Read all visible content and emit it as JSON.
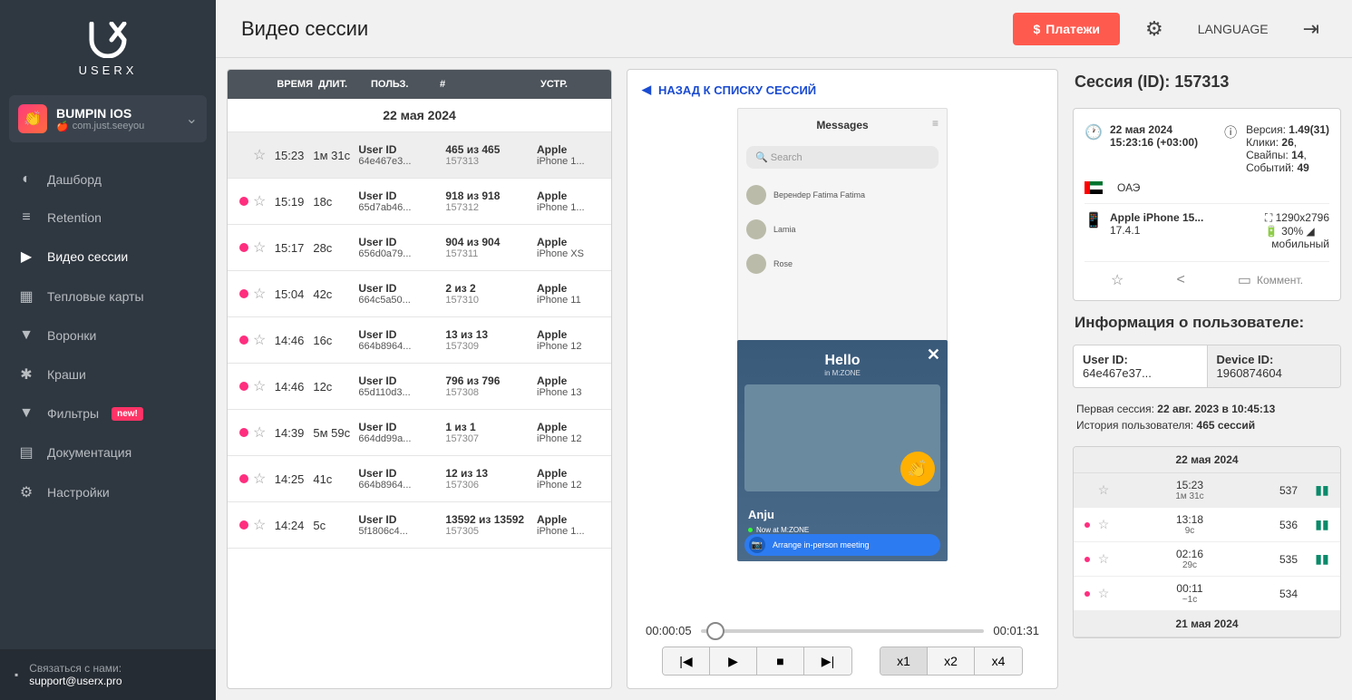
{
  "logo_text": "USERX",
  "app": {
    "name": "BUMPIN IOS",
    "id": "com.just.seeyou",
    "icon": "👏"
  },
  "nav": [
    {
      "icon": "◐",
      "label": "Дашборд"
    },
    {
      "icon": "≡",
      "label": "Retention"
    },
    {
      "icon": "▶",
      "label": "Видео сессии",
      "active": true
    },
    {
      "icon": "▦",
      "label": "Тепловые карты"
    },
    {
      "icon": "▼",
      "label": "Воронки"
    },
    {
      "icon": "✱",
      "label": "Краши"
    },
    {
      "icon": "▼",
      "label": "Фильтры",
      "badge": "new!"
    },
    {
      "icon": "▤",
      "label": "Документация"
    },
    {
      "icon": "⚙",
      "label": "Настройки"
    }
  ],
  "contact": {
    "label": "Связаться с нами:",
    "email": "support@userx.pro"
  },
  "page_title": "Видео сессии",
  "pay_btn": "Платежи",
  "lang": "LANGUAGE",
  "sess_head": {
    "time": "ВРЕМЯ",
    "dur": "ДЛИТ.",
    "user": "ПОЛЬЗ.",
    "num": "#",
    "dev": "УСТР."
  },
  "sess_date": "22 мая 2024",
  "sessions": [
    {
      "sel": true,
      "dot": false,
      "time": "15:23",
      "dur": "1м 31с",
      "uid": "64e467e3...",
      "num": "465 из 465",
      "sid": "157313",
      "dev": "Apple",
      "model": "iPhone 1..."
    },
    {
      "dot": true,
      "time": "15:19",
      "dur": "18с",
      "uid": "65d7ab46...",
      "num": "918 из 918",
      "sid": "157312",
      "dev": "Apple",
      "model": "iPhone 1..."
    },
    {
      "dot": true,
      "time": "15:17",
      "dur": "28с",
      "uid": "656d0a79...",
      "num": "904 из 904",
      "sid": "157311",
      "dev": "Apple",
      "model": "iPhone XS"
    },
    {
      "dot": true,
      "time": "15:04",
      "dur": "42с",
      "uid": "664c5a50...",
      "num": "2 из 2",
      "sid": "157310",
      "dev": "Apple",
      "model": "iPhone 11"
    },
    {
      "dot": true,
      "time": "14:46",
      "dur": "16с",
      "uid": "664b8964...",
      "num": "13 из 13",
      "sid": "157309",
      "dev": "Apple",
      "model": "iPhone 12"
    },
    {
      "dot": true,
      "time": "14:46",
      "dur": "12с",
      "uid": "65d110d3...",
      "num": "796 из 796",
      "sid": "157308",
      "dev": "Apple",
      "model": "iPhone 13"
    },
    {
      "dot": true,
      "time": "14:39",
      "dur": "5м 59с",
      "uid": "664dd99a...",
      "num": "1 из 1",
      "sid": "157307",
      "dev": "Apple",
      "model": "iPhone 12"
    },
    {
      "dot": true,
      "time": "14:25",
      "dur": "41с",
      "uid": "664b8964...",
      "num": "12 из 13",
      "sid": "157306",
      "dev": "Apple",
      "model": "iPhone 12"
    },
    {
      "dot": true,
      "time": "14:24",
      "dur": "5с",
      "uid": "5f1806c4...",
      "num": "13592 из 13592",
      "sid": "157305",
      "dev": "Apple",
      "model": "iPhone 1..."
    }
  ],
  "uid_label": "User ID",
  "player": {
    "back": "НАЗАД К СПИСКУ СЕССИЙ",
    "cur": "00:00:05",
    "total": "00:01:31",
    "speeds": [
      "x1",
      "x2",
      "x4"
    ]
  },
  "phone": {
    "title": "Messages",
    "search": "Search",
    "contacts": [
      "Веренdер Fatima Fatima",
      "Lamia",
      "Rose"
    ],
    "hello": "Hello",
    "sub": "in M:ZONE",
    "name": "Anju",
    "now": "Now at M:ZONE",
    "btn": "Arrange in-person meeting"
  },
  "detail": {
    "title_pre": "Сессия (ID): ",
    "title_id": "157313",
    "date": "22 мая 2024",
    "time": "15:23:16 (+03:00)",
    "ver_l": "Версия: ",
    "ver": "1.49(31)",
    "clk_l": "Клики: ",
    "clk": "26",
    "swp_l": "Свайпы: ",
    "swp": "14",
    "evt_l": "Событий: ",
    "evt": "49",
    "country": "ОАЭ",
    "device": "Apple iPhone 15...",
    "os": "17.4.1",
    "res": "1290x2796",
    "bat": "30%",
    "net": "мобильный",
    "comment": "Коммент."
  },
  "userinfo": {
    "header": "Информация о пользователе:",
    "uid_l": "User ID:",
    "uid": "64e467e37...",
    "did_l": "Device ID:",
    "did": "1960874604",
    "first_l": "Первая сессия: ",
    "first": "22 авг. 2023 в 10:45:13",
    "hist_l": "История пользователя: ",
    "hist": "465 сессий"
  },
  "history": {
    "date": "22 мая 2024",
    "rows": [
      {
        "sel": true,
        "dot": false,
        "t": "15:23",
        "d": "1м 31с",
        "id": "537",
        "film": true
      },
      {
        "dot": true,
        "t": "13:18",
        "d": "9с",
        "id": "536",
        "film": true
      },
      {
        "dot": true,
        "t": "02:16",
        "d": "29с",
        "id": "535",
        "film": true
      },
      {
        "dot": true,
        "t": "00:11",
        "d": "~1с",
        "id": "534",
        "film": false
      }
    ],
    "date2": "21 мая 2024"
  }
}
